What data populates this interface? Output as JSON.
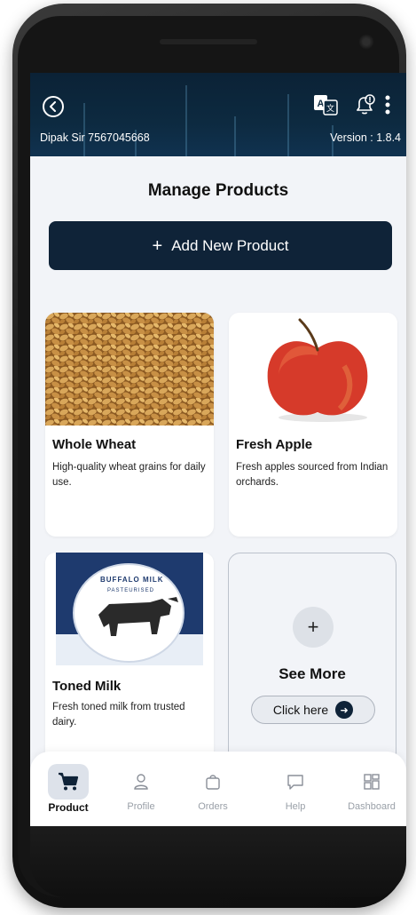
{
  "header": {
    "user": "Dipak Sir 7567045668",
    "version": "Version : 1.8.4",
    "icons": [
      "back-icon",
      "translate-icon",
      "bell-icon",
      "more-vertical-icon"
    ]
  },
  "page": {
    "title": "Manage Products",
    "add_button": "Add New Product",
    "add_symbol": "+"
  },
  "products": [
    {
      "name": "Whole Wheat",
      "description": "High-quality wheat grains for daily use."
    },
    {
      "name": "Fresh Apple",
      "description": "Fresh apples sourced from Indian orchards."
    },
    {
      "name": "Toned Milk",
      "description": "Fresh toned milk from trusted dairy."
    }
  ],
  "milk_pack": {
    "line1": "BUFFALO MILK",
    "line2": "PASTEURISED"
  },
  "see_more": {
    "symbol": "+",
    "title": "See More",
    "button": "Click here"
  },
  "nav": [
    {
      "label": "Product",
      "icon": "cart-icon",
      "active": true
    },
    {
      "label": "Profile",
      "icon": "user-icon",
      "active": false
    },
    {
      "label": "Orders",
      "icon": "bag-icon",
      "active": false
    },
    {
      "label": "Help",
      "icon": "chat-icon",
      "active": false
    },
    {
      "label": "Dashboard",
      "icon": "grid-icon",
      "active": false
    }
  ],
  "colors": {
    "primary": "#0f2338",
    "header": "#0d2a40",
    "background": "#f2f4f8"
  }
}
